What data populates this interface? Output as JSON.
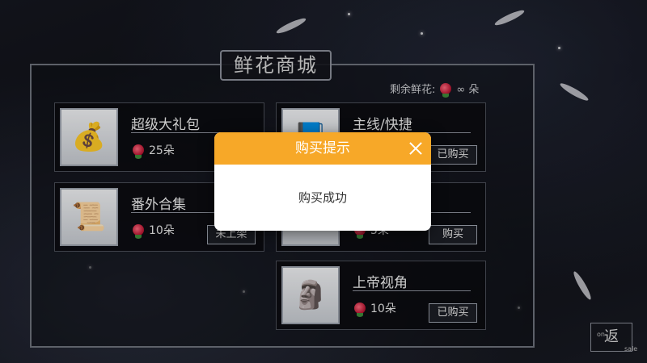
{
  "shop": {
    "title": "鲜花商城",
    "remaining_label": "剩余鲜花:",
    "remaining_value": "∞ 朵"
  },
  "items": [
    {
      "name": "超级大礼包",
      "price": "25朵",
      "status": "",
      "icon": "gift-bag-icon"
    },
    {
      "name": "主线/快捷",
      "price": "",
      "status": "已购买",
      "icon": "book-icon"
    },
    {
      "name": "番外合集",
      "price": "10朵",
      "status": "未上架",
      "icon": "scroll-icon"
    },
    {
      "name": "",
      "price": "5朵",
      "status": "购买",
      "icon": "item-icon"
    },
    {
      "name": "上帝视角",
      "price": "10朵",
      "status": "已购买",
      "icon": "buddha-statue-icon"
    }
  ],
  "dialog": {
    "title": "购买提示",
    "message": "购买成功"
  },
  "return_button": {
    "label": "返",
    "small_left": "on",
    "small_right": "sale"
  },
  "colors": {
    "dialog_header": "#f7a828",
    "dialog_body": "#ffffff"
  }
}
